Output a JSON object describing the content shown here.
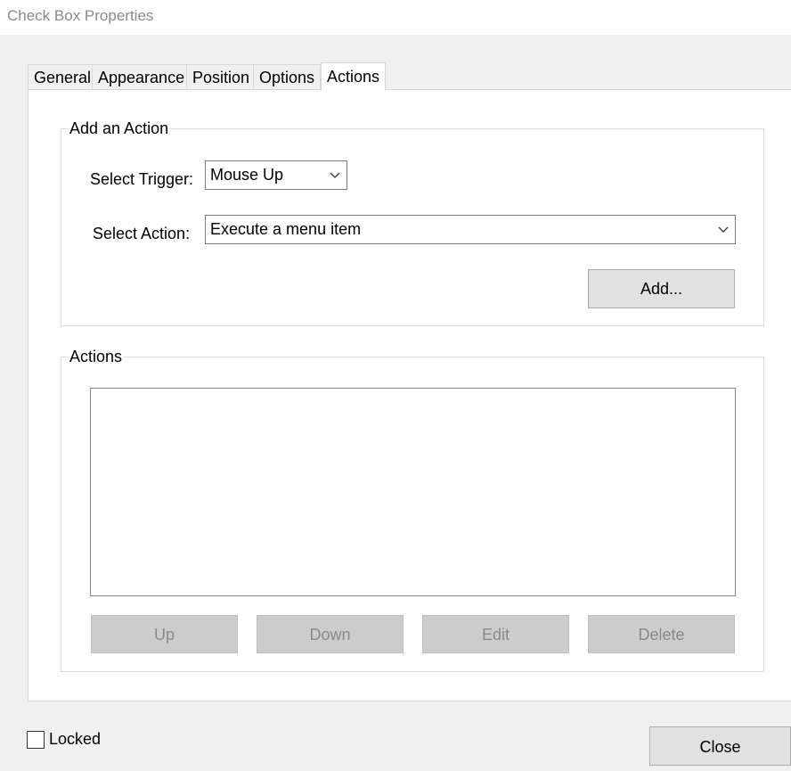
{
  "window": {
    "title": "Check Box Properties"
  },
  "tabs": [
    {
      "label": "General"
    },
    {
      "label": "Appearance"
    },
    {
      "label": "Position"
    },
    {
      "label": "Options"
    },
    {
      "label": "Actions",
      "active": true
    }
  ],
  "add_action": {
    "group_label": "Add an Action",
    "trigger_label": "Select Trigger:",
    "trigger_value": "Mouse Up",
    "action_label": "Select Action:",
    "action_value": "Execute a menu item",
    "add_button": "Add..."
  },
  "actions": {
    "group_label": "Actions",
    "items": [],
    "buttons": {
      "up": "Up",
      "down": "Down",
      "edit": "Edit",
      "delete": "Delete"
    }
  },
  "footer": {
    "locked_label": "Locked",
    "locked_checked": false,
    "close_button": "Close"
  },
  "icons": {
    "dropdown": "chevron-down-icon"
  }
}
